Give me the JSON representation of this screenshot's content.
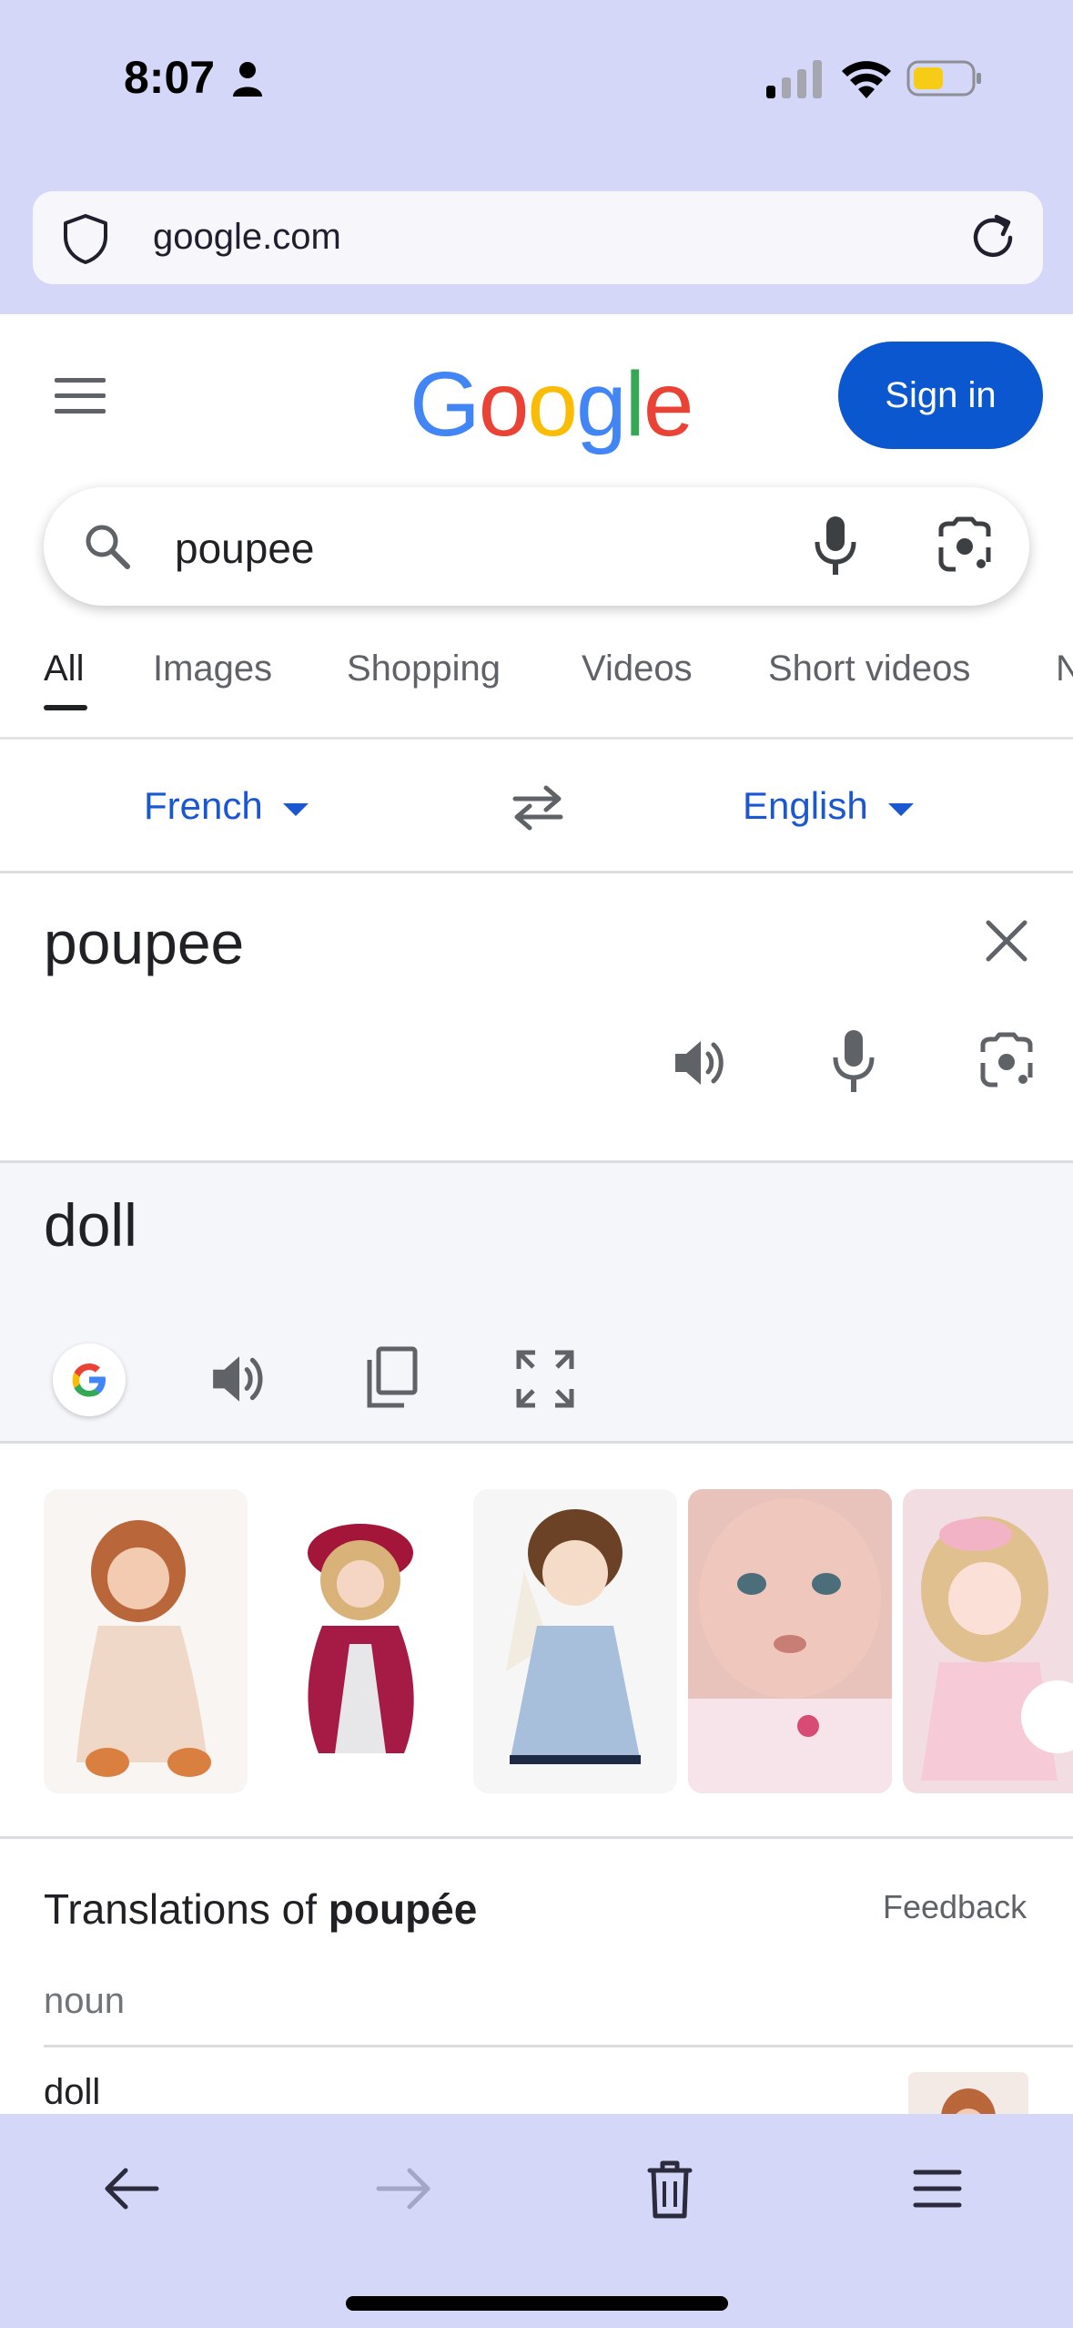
{
  "status_bar": {
    "time": "8:07"
  },
  "browser": {
    "url": "google.com"
  },
  "google": {
    "logo_letters": [
      {
        "char": "G",
        "color": "#4285F4"
      },
      {
        "char": "o",
        "color": "#EA4335"
      },
      {
        "char": "o",
        "color": "#FBBC05"
      },
      {
        "char": "g",
        "color": "#4285F4"
      },
      {
        "char": "l",
        "color": "#34A853"
      },
      {
        "char": "e",
        "color": "#EA4335"
      }
    ],
    "sign_in_label": "Sign in",
    "search_query": "poupee",
    "tabs": [
      "All",
      "Images",
      "Shopping",
      "Videos",
      "Short videos",
      "N"
    ]
  },
  "translate": {
    "source_language": "French",
    "target_language": "English",
    "source_text": "poupee",
    "target_text": "doll"
  },
  "translations": {
    "title_prefix": "Translations of ",
    "title_word": "poupée",
    "feedback_label": "Feedback",
    "part_of_speech": "noun",
    "rows": [
      {
        "word": "doll"
      }
    ]
  },
  "colors": {
    "accent": "#0b57d0",
    "link_blue": "#1a57d0",
    "chrome_background": "#d5d7f8"
  }
}
